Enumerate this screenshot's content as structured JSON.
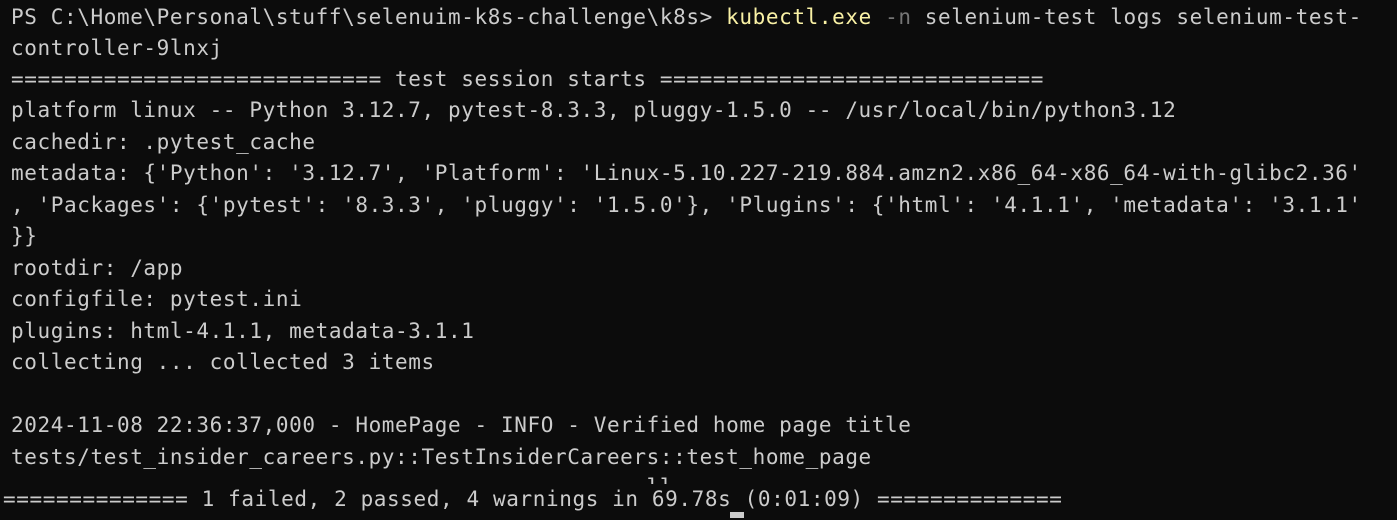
{
  "terminal": {
    "prompt": "PS C:\\Home\\Personal\\stuff\\selenuim-k8s-challenge\\k8s> ",
    "command": "kubectl.exe",
    "flag": " -n",
    "args": " selenium-test logs selenium-test-",
    "args_wrap": "controller-9lnxj",
    "lines": [
      "============================ test session starts =============================",
      "platform linux -- Python 3.12.7, pytest-8.3.3, pluggy-1.5.0 -- /usr/local/bin/python3.12",
      "cachedir: .pytest_cache",
      "metadata: {'Python': '3.12.7', 'Platform': 'Linux-5.10.227-219.884.amzn2.x86_64-x86_64-with-glibc2.36'",
      ", 'Packages': {'pytest': '8.3.3', 'pluggy': '1.5.0'}, 'Plugins': {'html': '4.1.1', 'metadata': '3.1.1'",
      "}}",
      "rootdir: /app",
      "configfile: pytest.ini",
      "plugins: html-4.1.1, metadata-3.1.1",
      "collecting ... collected 3 items",
      "",
      "2024-11-08 22:36:37,000 - HomePage - INFO - Verified home page title",
      "tests/test_insider_careers.py::TestInsiderCareers::test_home_page"
    ],
    "overlap_text": "                   ll",
    "summary": "============== 1 failed, 2 passed, 4 warnings in 69.78s (0:01:09) =============="
  },
  "colors": {
    "background": "#0c0c0c",
    "foreground": "#cccccc",
    "command": "#f9f1a5",
    "flag": "#767676"
  }
}
